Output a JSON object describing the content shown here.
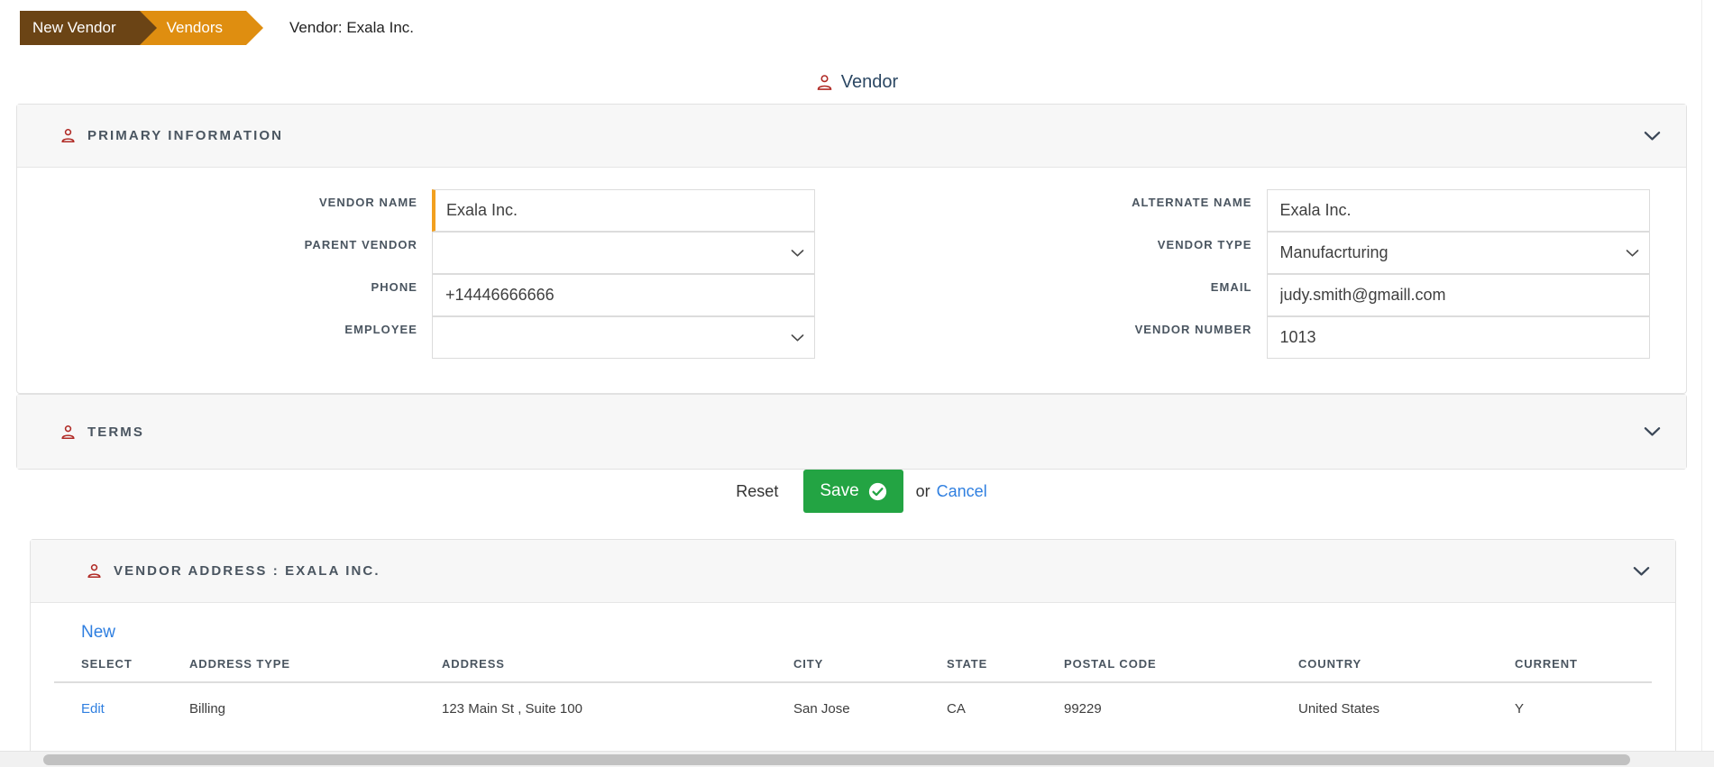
{
  "breadcrumb": {
    "items": [
      {
        "label": "New Vendor",
        "color": "#6b4415"
      },
      {
        "label": "Vendors",
        "color": "#df8e10"
      }
    ],
    "current": "Vendor: Exala Inc."
  },
  "page": {
    "title": "Vendor",
    "title_icon": "person-icon"
  },
  "primary_panel": {
    "title": "PRIMARY INFORMATION",
    "icon": "person-icon",
    "collapse_icon": "chevron-down-icon",
    "left_fields": [
      {
        "label": "VENDOR NAME",
        "value": "Exala Inc.",
        "type": "text",
        "required": true
      },
      {
        "label": "PARENT VENDOR",
        "value": "",
        "type": "select"
      },
      {
        "label": "PHONE",
        "value": "+14446666666",
        "type": "text"
      },
      {
        "label": "EMPLOYEE",
        "value": "",
        "type": "select"
      }
    ],
    "right_fields": [
      {
        "label": "ALTERNATE NAME",
        "value": "Exala Inc.",
        "type": "text"
      },
      {
        "label": "VENDOR TYPE",
        "value": "Manufacrturing",
        "type": "select"
      },
      {
        "label": "EMAIL",
        "value": "judy.smith@gmaill.com",
        "type": "text"
      },
      {
        "label": "VENDOR NUMBER",
        "value": "1013",
        "type": "text"
      }
    ]
  },
  "terms_panel": {
    "title": "TERMS",
    "icon": "person-icon",
    "collapse_icon": "chevron-down-icon"
  },
  "actions": {
    "reset_label": "Reset",
    "save_label": "Save",
    "save_icon": "check-circle-icon",
    "or_label": "or",
    "cancel_label": "Cancel",
    "save_color": "#23a443",
    "link_color": "#2f7fe0"
  },
  "address_panel": {
    "title": "VENDOR ADDRESS : EXALA INC.",
    "icon": "person-icon",
    "collapse_icon": "chevron-down-icon",
    "new_label": "New",
    "columns": [
      "SELECT",
      "ADDRESS TYPE",
      "ADDRESS",
      "CITY",
      "STATE",
      "POSTAL CODE",
      "COUNTRY",
      "CURRENT"
    ],
    "rows": [
      {
        "select": "Edit",
        "address_type": "Billing",
        "address": "123 Main St , Suite 100",
        "city": "San Jose",
        "state": "CA",
        "postal_code": "99229",
        "country": "United States",
        "current": "Y"
      }
    ]
  }
}
